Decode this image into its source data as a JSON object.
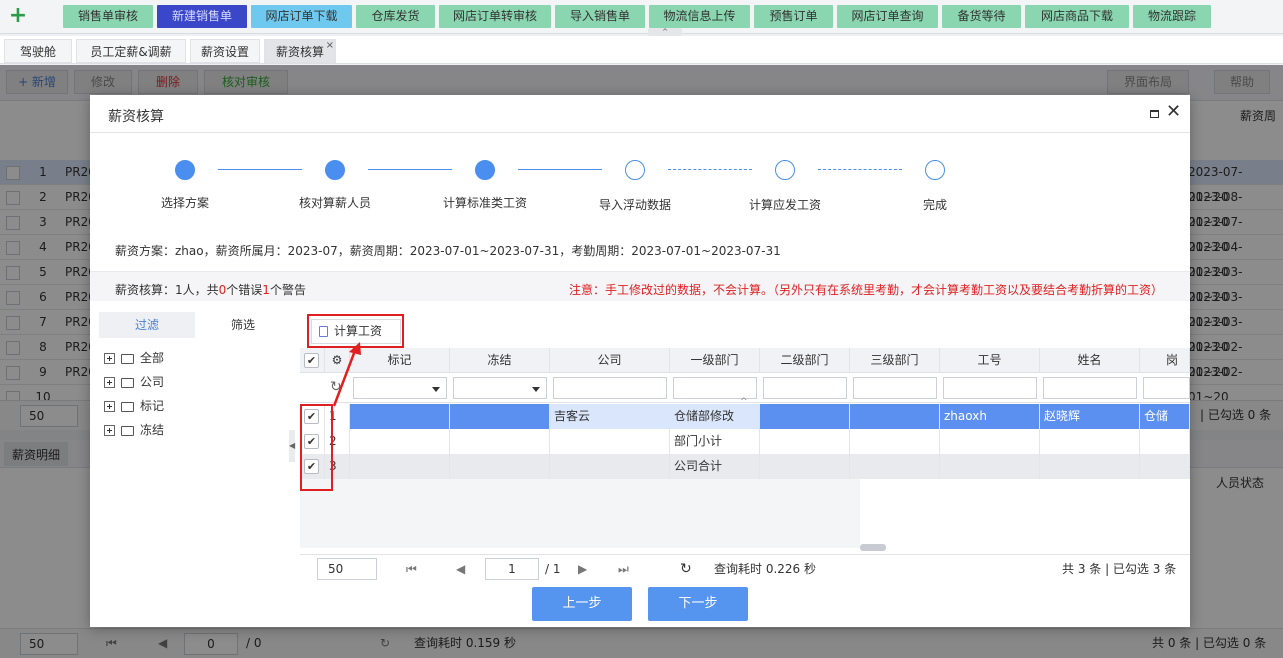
{
  "topmenu": {
    "plus": "+",
    "items": [
      {
        "label": "销售单审核",
        "state": "normal"
      },
      {
        "label": "新建销售单",
        "state": "active"
      },
      {
        "label": "网店订单下载",
        "state": "light"
      },
      {
        "label": "仓库发货",
        "state": "normal"
      },
      {
        "label": "网店订单转审核",
        "state": "normal"
      },
      {
        "label": "导入销售单",
        "state": "normal"
      },
      {
        "label": "物流信息上传",
        "state": "normal"
      },
      {
        "label": "预售订单",
        "state": "normal"
      },
      {
        "label": "网店订单查询",
        "state": "normal"
      },
      {
        "label": "备货等待",
        "state": "normal"
      },
      {
        "label": "网店商品下载",
        "state": "normal"
      },
      {
        "label": "物流跟踪",
        "state": "normal"
      }
    ],
    "collapse": "^"
  },
  "tabs": [
    "驾驶舱",
    "员工定薪&调薪",
    "薪资设置",
    "薪资核算"
  ],
  "tab_close": "×",
  "bg": {
    "toolbar": {
      "add": "+ 新增",
      "edit": "修改",
      "delete": "删除",
      "verify": "核对审核",
      "layout": "界面布局",
      "help": "帮助"
    },
    "col_right": "薪资周",
    "rows": [
      {
        "n": "1",
        "pr": "PR20",
        "date": "2023-07-01~20"
      },
      {
        "n": "2",
        "pr": "PR20",
        "date": "2023-08-01~20"
      },
      {
        "n": "3",
        "pr": "PR20",
        "date": "2023-07-01~20"
      },
      {
        "n": "4",
        "pr": "PR20",
        "date": "2023-04-01~20"
      },
      {
        "n": "5",
        "pr": "PR20",
        "date": "2023-03-01~20"
      },
      {
        "n": "6",
        "pr": "PR20",
        "date": "2023-03-01~20"
      },
      {
        "n": "7",
        "pr": "PR20",
        "date": "2023-03-01~20"
      },
      {
        "n": "8",
        "pr": "PR20",
        "date": "2023-02-01~20"
      },
      {
        "n": "9",
        "pr": "PR20",
        "date": "2023-02-01~20"
      },
      {
        "n": "10",
        "pr": "",
        "date": ""
      }
    ],
    "pager1": {
      "size": "50",
      "status": "| 已勾选 0 条"
    },
    "detail_tab": "薪资明细",
    "detail_col": "人员状态",
    "pager2": {
      "size": "50",
      "page": "0",
      "total": "/ 0",
      "time": "查询耗时 0.159 秒",
      "status": "共 0 条 | 已勾选 0 条"
    }
  },
  "dialog": {
    "title": "薪资核算",
    "steps": [
      {
        "label": "选择方案",
        "done": true
      },
      {
        "label": "核对算薪人员",
        "done": true
      },
      {
        "label": "计算标准类工资",
        "done": true
      },
      {
        "label": "导入浮动数据",
        "done": false
      },
      {
        "label": "计算应发工资",
        "done": false
      },
      {
        "label": "完成",
        "done": false
      }
    ],
    "info": "薪资方案：zhao，薪资所属月：2023-07，薪资周期：2023-07-01~2023-07-31，考勤周期：2023-07-01~2023-07-31",
    "summary": {
      "a": "薪资核算：1人，共",
      "errors": "0",
      "b": "个错误",
      "warnings": "1",
      "c": "个警告"
    },
    "warning": "注意：手工修改过的数据，不会计算。（另外只有在系统里考勤，才会计算考勤工资以及要结合考勤折算的工资）",
    "left": {
      "tab_filter": "过滤",
      "tab_select": "筛选",
      "tree": [
        "全部",
        "公司",
        "标记",
        "冻结"
      ]
    },
    "calc_btn": "计算工资",
    "columns": [
      "标记",
      "冻结",
      "公司",
      "一级部门",
      "二级部门",
      "三级部门",
      "工号",
      "姓名",
      "岗"
    ],
    "rows": [
      {
        "n": "1",
        "company": "吉客云",
        "dept1": "仓储部修改",
        "emp": "zhaoxh",
        "name": "赵晓辉",
        "post": "仓储",
        "selected": true
      },
      {
        "n": "2",
        "company": "",
        "dept1": "部门小计",
        "emp": "",
        "name": "",
        "post": "",
        "selected": false
      },
      {
        "n": "3",
        "company": "",
        "dept1": "公司合计",
        "emp": "",
        "name": "",
        "post": "",
        "selected": false
      }
    ],
    "check": "✔",
    "pager": {
      "size": "50",
      "page": "1",
      "total": "/ 1",
      "time": "查询耗时 0.226 秒",
      "status": "共 3 条 | 已勾选 3 条"
    },
    "prev": "上一步",
    "next": "下一步"
  },
  "colors": {
    "accent": "#4a8ef0",
    "highlight": "#e02020",
    "menu_green": "#8ad6b0",
    "menu_active": "#3a47c8"
  }
}
